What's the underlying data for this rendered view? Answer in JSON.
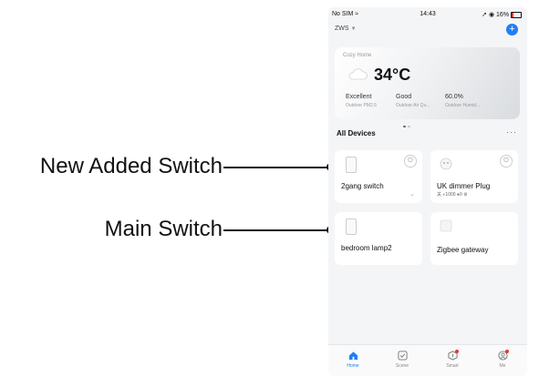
{
  "callouts": {
    "new_added": "New Added Switch",
    "main": "Main Switch"
  },
  "status_bar": {
    "carrier": "No SIM",
    "time": "14:43",
    "battery": "16%"
  },
  "header": {
    "home_name": "ZWS",
    "add_icon": "plus-icon"
  },
  "weather": {
    "home_label": "Cozy Home",
    "temperature": "34°C",
    "stats": [
      {
        "value": "Excellent",
        "label": "Outdoor PM2.5"
      },
      {
        "value": "Good",
        "label": "Outdoor Air Qu..."
      },
      {
        "value": "60.0%",
        "label": "Outdoor Humid..."
      }
    ]
  },
  "devices_section": {
    "title": "All Devices",
    "more": "···"
  },
  "devices": [
    {
      "name": "2gang switch"
    },
    {
      "name": "UK dimmer Plug",
      "meta": "关  ◗1000  ●0 ⚙"
    },
    {
      "name": "bedroom lamp2"
    },
    {
      "name": "Zigbee gateway"
    }
  ],
  "tabs": [
    {
      "label": "Home",
      "icon": "home-icon",
      "active": true
    },
    {
      "label": "Scene",
      "icon": "scene-icon"
    },
    {
      "label": "Smart",
      "icon": "smart-icon"
    },
    {
      "label": "Me",
      "icon": "profile-icon"
    }
  ],
  "colors": {
    "accent": "#1f7ef7",
    "badge": "#e53935",
    "background": "#f4f5f7"
  }
}
